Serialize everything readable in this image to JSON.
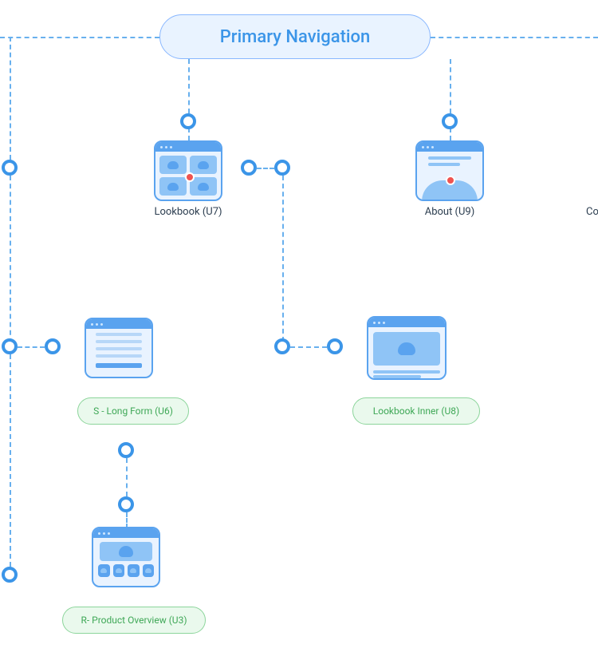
{
  "title": "Primary Navigation",
  "nodes": {
    "lookbook": {
      "label": "Lookbook (U7)"
    },
    "about": {
      "label": "About (U9)"
    },
    "truncated_right": {
      "label": "Co"
    },
    "long_form": {
      "label": "S - Long Form (U6)"
    },
    "lookbook_inner": {
      "label": "Lookbook Inner (U8)"
    },
    "product_overview": {
      "label": "R- Product Overview (U3)"
    }
  }
}
